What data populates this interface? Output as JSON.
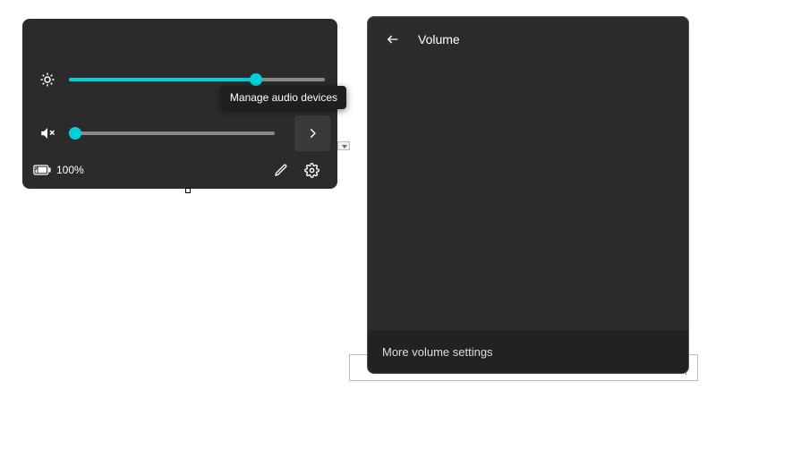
{
  "colors": {
    "accent": "#00d1d9"
  },
  "quick_settings": {
    "brightness": {
      "value_pct": 73
    },
    "volume": {
      "muted": true,
      "value_pct": 3
    },
    "expand_tooltip": "Manage audio devices",
    "battery": {
      "label": "100%"
    }
  },
  "volume_panel": {
    "title": "Volume",
    "footer_link": "More volume settings"
  },
  "peek": {
    "battery_label": "100%"
  }
}
